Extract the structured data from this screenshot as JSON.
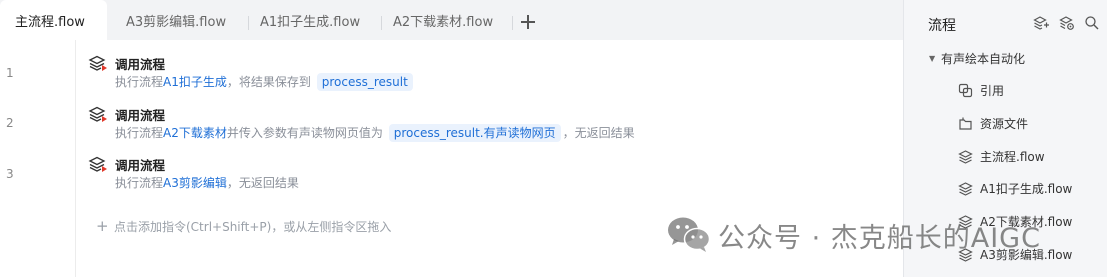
{
  "tabs": [
    {
      "label": "主流程.flow",
      "active": true
    },
    {
      "label": "A3剪影编辑.flow",
      "active": false
    },
    {
      "label": "A1扣子生成.flow",
      "active": false
    },
    {
      "label": "A2下载素材.flow",
      "active": false
    }
  ],
  "tab_add_icon": "plus-icon",
  "line_numbers": [
    "1",
    "2",
    "3"
  ],
  "steps": [
    {
      "title": "调用流程",
      "desc_prefix": "执行流程",
      "flow_name": "A1扣子生成",
      "desc_mid": "，将结果保存到",
      "var_chip": "process_result",
      "desc_suffix": "",
      "icon": "layers-icon"
    },
    {
      "title": "调用流程",
      "desc_prefix": "执行流程",
      "flow_name": "A2下载素材",
      "desc_mid": "并传入参数有声读物网页值为",
      "var_chip": "process_result.有声读物网页",
      "desc_suffix": "，无返回结果",
      "icon": "layers-icon"
    },
    {
      "title": "调用流程",
      "desc_prefix": "执行流程",
      "flow_name": "A3剪影编辑",
      "desc_mid": "，无返回结果",
      "var_chip": "",
      "desc_suffix": "",
      "icon": "layers-icon"
    }
  ],
  "add_hint": "点击添加指令(Ctrl+Shift+P)，或从左侧指令区拖入",
  "panel": {
    "title": "流程",
    "tools": [
      "add-flow-icon",
      "settings-flow-icon",
      "search-icon"
    ],
    "group": "有声绘本自动化",
    "items": [
      {
        "label": "引用",
        "icon": "reference-icon"
      },
      {
        "label": "资源文件",
        "icon": "resource-file-icon"
      },
      {
        "label": "主流程.flow",
        "icon": "flow-icon"
      },
      {
        "label": "A1扣子生成.flow",
        "icon": "flow-icon"
      },
      {
        "label": "A2下载素材.flow",
        "icon": "flow-icon"
      },
      {
        "label": "A3剪影编辑.flow",
        "icon": "flow-icon"
      }
    ]
  },
  "watermark": {
    "text": "公众号 · 杰克船长的AIGC",
    "icon": "wechat-icon"
  },
  "colors": {
    "accent": "#1f6fd6",
    "chip_bg": "#eaf2fd",
    "tab_bar": "#f2f3f5",
    "panel_bg": "#f5f6f8",
    "step_icon_red": "#e0392b"
  }
}
